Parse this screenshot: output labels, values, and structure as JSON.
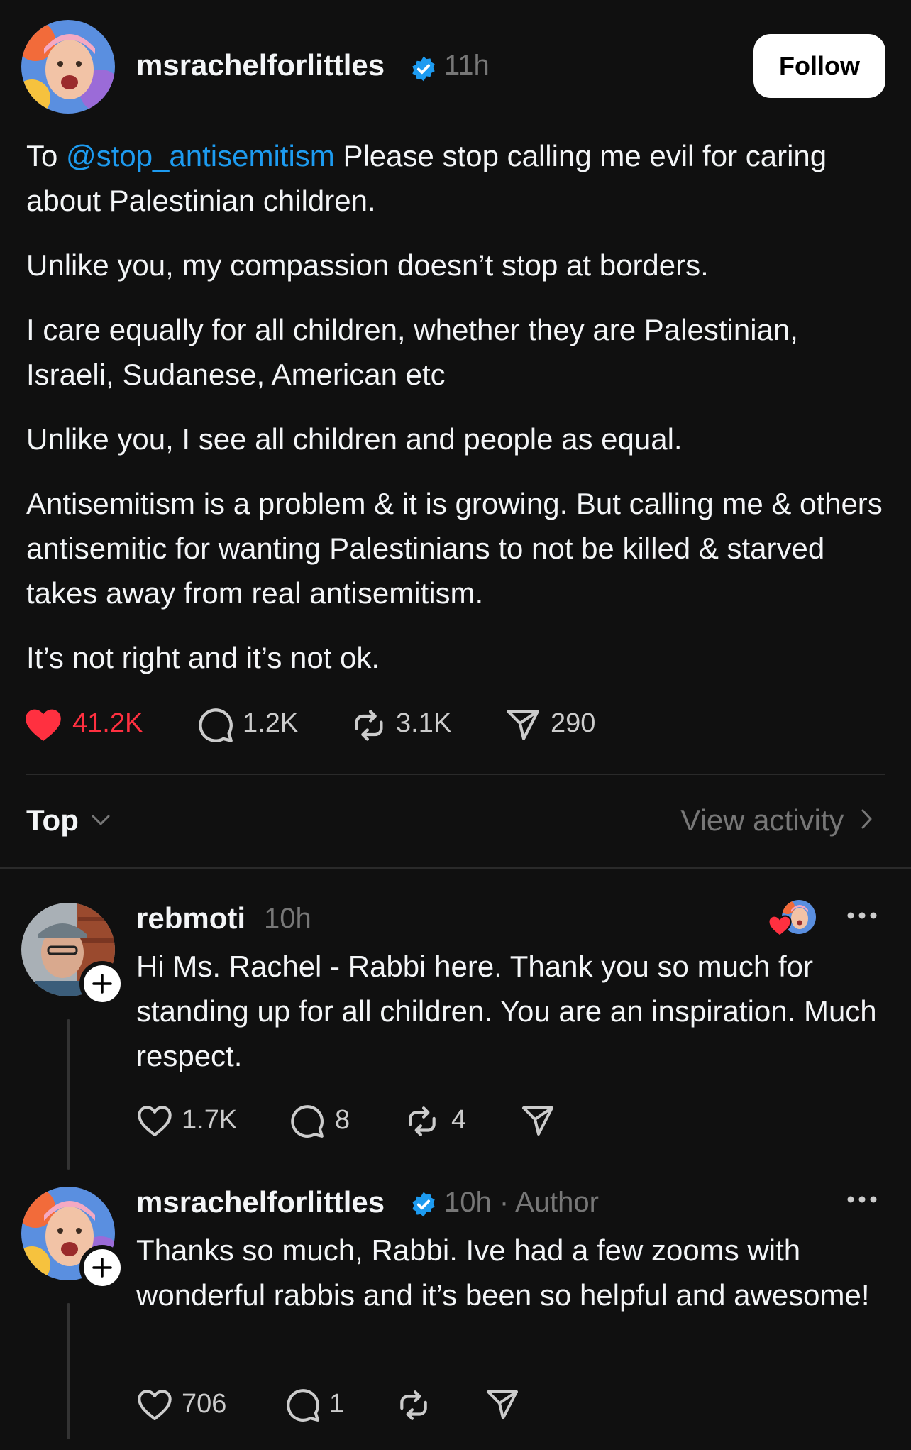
{
  "post": {
    "username": "msrachelforlittles",
    "time": "11h",
    "follow_label": "Follow",
    "mention": "@stop_antisemitism",
    "p1_rest": " Please stop calling me evil for caring about Palestinian children.",
    "p2": "Unlike you, my compassion doesn’t stop at borders.",
    "p3": "I care equally for all children, whether they are Palestinian, Israeli, Sudanese, American etc",
    "p4": "Unlike you, I see all children and people as equal.",
    "p5": "Antisemitism is a problem & it is growing. But calling me & others antisemitic for wanting Palestinians to not be killed & starved takes away from real antisemitism.",
    "p6": "It’s not right and it’s not ok.",
    "likes": "41.2K",
    "replies": "1.2K",
    "reposts": "3.1K",
    "shares": "290",
    "liked": true
  },
  "sort": {
    "label": "Top",
    "view_activity": "View activity"
  },
  "replies": [
    {
      "username": "rebmoti",
      "time": "10h",
      "text": "Hi Ms. Rachel - Rabbi here. Thank you so much for standing up for all children. You are an inspiration. Much respect.",
      "likes": "1.7K",
      "replies": "8",
      "reposts": "4"
    },
    {
      "username": "msrachelforlittles",
      "time": "10h",
      "author_tag": " · Author",
      "text": "Thanks so much, Rabbi. Ive had a few zooms with wonderful rabbis and it’s been so helpful and awesome!",
      "likes": "706",
      "replies": "1"
    }
  ],
  "colors": {
    "background": "#101010",
    "verified": "#1d9bf0",
    "liked": "#ff3040"
  }
}
